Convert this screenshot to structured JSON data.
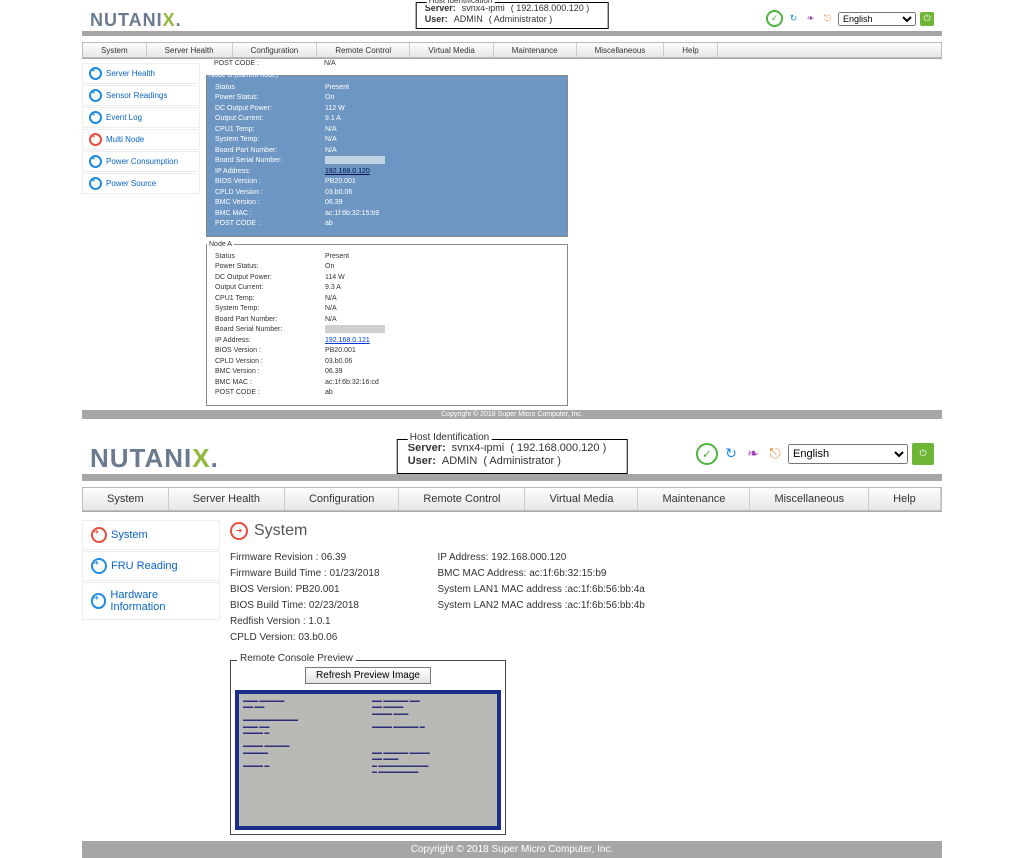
{
  "brand": "NUTANIX.",
  "host": {
    "legend": "Host Identification",
    "server_label": "Server:",
    "server_name": "svnx4-ipmi",
    "server_ip": "( 192.168.000.120 )",
    "user_label": "User:",
    "user_name": "ADMIN",
    "user_role": "( Administrator )"
  },
  "language": "English",
  "menu": [
    "System",
    "Server Health",
    "Configuration",
    "Remote Control",
    "Virtual Media",
    "Maintenance",
    "Miscellaneous",
    "Help"
  ],
  "top": {
    "sidebar": [
      {
        "label": "Server Health",
        "red": false
      },
      {
        "label": "Sensor Readings",
        "red": false
      },
      {
        "label": "Event Log",
        "red": false
      },
      {
        "label": "Multi Node",
        "red": true
      },
      {
        "label": "Power Consumption",
        "red": false
      },
      {
        "label": "Power Source",
        "red": false
      }
    ],
    "post_code_label": "POST CODE :",
    "post_code_value": "N/A",
    "nodeB": {
      "legend": "Node B (current node)",
      "rows": [
        {
          "k": "Status",
          "v": "Present"
        },
        {
          "k": "Power Status:",
          "v": "On"
        },
        {
          "k": "DC Output Power:",
          "v": "112 W"
        },
        {
          "k": "Output Current:",
          "v": "9.1 A"
        },
        {
          "k": "CPU1 Temp:",
          "v": "N/A"
        },
        {
          "k": "System Temp:",
          "v": "N/A"
        },
        {
          "k": "Board Part Number:",
          "v": "N/A"
        },
        {
          "k": "Board Serial Number:",
          "v": ""
        },
        {
          "k": "IP Address:",
          "v": "192.168.0.120",
          "link": true
        },
        {
          "k": "BIOS Version :",
          "v": "PB20.001"
        },
        {
          "k": "CPLD Version :",
          "v": "03.b0.06"
        },
        {
          "k": "BMC Version :",
          "v": "06.39"
        },
        {
          "k": "BMC MAC :",
          "v": "ac:1f:6b:32:15:b9"
        },
        {
          "k": "POST CODE :",
          "v": "ab"
        }
      ]
    },
    "nodeA": {
      "legend": "Node A",
      "rows": [
        {
          "k": "Status",
          "v": "Present"
        },
        {
          "k": "Power Status:",
          "v": "On"
        },
        {
          "k": "DC Output Power:",
          "v": "114 W"
        },
        {
          "k": "Output Current:",
          "v": "9.3 A"
        },
        {
          "k": "CPU1 Temp:",
          "v": "N/A"
        },
        {
          "k": "System Temp:",
          "v": "N/A"
        },
        {
          "k": "Board Part Number:",
          "v": "N/A"
        },
        {
          "k": "Board Serial Number:",
          "v": ""
        },
        {
          "k": "IP Address:",
          "v": "192.168.0.121",
          "link": true
        },
        {
          "k": "BIOS Version :",
          "v": "PB20.001"
        },
        {
          "k": "CPLD Version :",
          "v": "03.b0.06"
        },
        {
          "k": "BMC Version :",
          "v": "06.39"
        },
        {
          "k": "BMC MAC :",
          "v": "ac:1f:6b:32:16:cd"
        },
        {
          "k": "POST CODE :",
          "v": "ab"
        }
      ]
    }
  },
  "bottom": {
    "sidebar": [
      {
        "label": "System",
        "red": true
      },
      {
        "label": "FRU Reading",
        "red": false
      },
      {
        "label": "Hardware Information",
        "red": false
      }
    ],
    "heading": "System",
    "left_info": [
      "Firmware Revision :  06.39",
      "Firmware Build Time :  01/23/2018",
      "BIOS Version: PB20.001",
      "BIOS Build Time: 02/23/2018",
      "Redfish Version : 1.0.1",
      "CPLD Version: 03.b0.06"
    ],
    "right_info": [
      "IP Address:  192.168.000.120",
      "BMC MAC Address:  ac:1f:6b:32:15:b9",
      "System LAN1 MAC address :ac:1f:6b:56:bb:4a",
      "System LAN2 MAC address :ac:1f:6b:56:bb:4b"
    ],
    "preview_legend": "Remote Console Preview",
    "refresh_label": "Refresh Preview Image"
  },
  "copyright": "Copyright © 2018 Super Micro Computer, Inc."
}
